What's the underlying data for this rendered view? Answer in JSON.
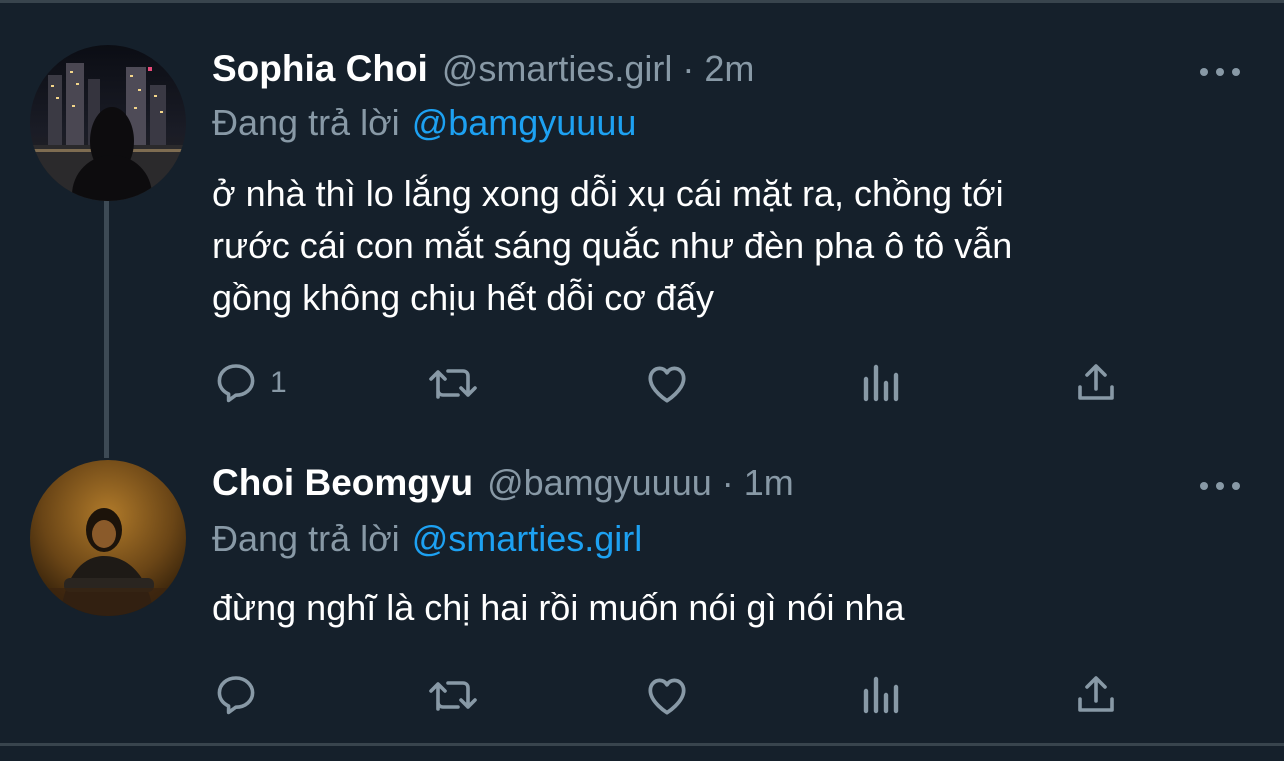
{
  "colors": {
    "background": "#15202b",
    "text_primary": "#ffffff",
    "text_secondary": "#8899a6",
    "accent": "#1da1f2",
    "divider": "#38444d"
  },
  "tweets": [
    {
      "name": "Sophia Choi",
      "handle": "@smarties.girl",
      "separator": "·",
      "time": "2m",
      "reply_prefix": "Đang trả lời",
      "reply_to": "@bamgyuuuu",
      "text_lines": [
        "ở nhà thì lo lắng xong dỗi xụ cái mặt ra, chồng tới",
        "rước cái con mắt sáng quắc như đèn pha ô tô vẫn",
        "gồng không chịu hết dỗi cơ đấy"
      ],
      "reply_count": "1",
      "icons": [
        "reply-icon",
        "retweet-icon",
        "like-icon",
        "analytics-icon",
        "share-icon",
        "more-icon"
      ]
    },
    {
      "name": "Choi Beomgyu",
      "handle": "@bamgyuuuu",
      "separator": "·",
      "time": "1m",
      "reply_prefix": "Đang trả lời",
      "reply_to": "@smarties.girl",
      "text_lines": [
        "đừng nghĩ là chị hai rồi muốn nói gì nói nha"
      ],
      "reply_count": "",
      "icons": [
        "reply-icon",
        "retweet-icon",
        "like-icon",
        "analytics-icon",
        "share-icon",
        "more-icon"
      ]
    }
  ]
}
